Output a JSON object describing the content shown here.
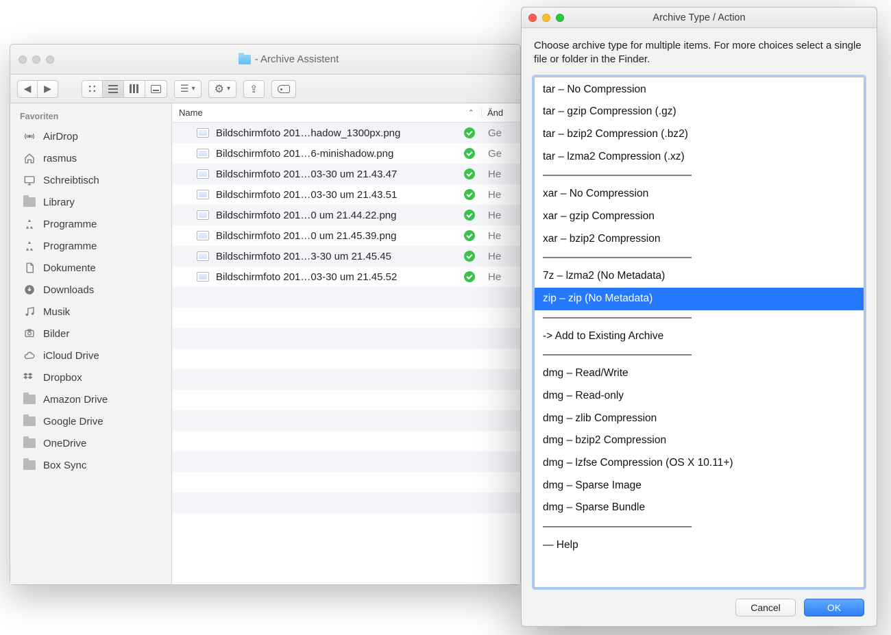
{
  "finder": {
    "title": " - Archive Assistent",
    "sidebar_header": "Favoriten",
    "sidebar": [
      {
        "icon": "airdrop",
        "label": "AirDrop"
      },
      {
        "icon": "home",
        "label": "rasmus"
      },
      {
        "icon": "desktop",
        "label": "Schreibtisch"
      },
      {
        "icon": "folder",
        "label": "Library"
      },
      {
        "icon": "apps",
        "label": "Programme"
      },
      {
        "icon": "apps",
        "label": "Programme"
      },
      {
        "icon": "documents",
        "label": "Dokumente"
      },
      {
        "icon": "downloads",
        "label": "Downloads"
      },
      {
        "icon": "music",
        "label": "Musik"
      },
      {
        "icon": "pictures",
        "label": "Bilder"
      },
      {
        "icon": "cloud",
        "label": "iCloud Drive"
      },
      {
        "icon": "dropbox",
        "label": "Dropbox"
      },
      {
        "icon": "folder",
        "label": "Amazon Drive"
      },
      {
        "icon": "folder",
        "label": "Google Drive"
      },
      {
        "icon": "folder",
        "label": "OneDrive"
      },
      {
        "icon": "folder",
        "label": "Box Sync"
      }
    ],
    "columns": {
      "name": "Name",
      "mod": "Änd"
    },
    "files": [
      {
        "name": "Bildschirmfoto 201…hadow_1300px.png",
        "mod": "Ge"
      },
      {
        "name": "Bildschirmfoto 201…6-minishadow.png",
        "mod": "Ge"
      },
      {
        "name": "Bildschirmfoto 201…03-30 um 21.43.47",
        "mod": "He"
      },
      {
        "name": "Bildschirmfoto 201…03-30 um 21.43.51",
        "mod": "He"
      },
      {
        "name": "Bildschirmfoto 201…0 um 21.44.22.png",
        "mod": "He"
      },
      {
        "name": "Bildschirmfoto 201…0 um 21.45.39.png",
        "mod": "He"
      },
      {
        "name": "Bildschirmfoto 201…3-30 um 21.45.45",
        "mod": "He"
      },
      {
        "name": "Bildschirmfoto 201…03-30 um 21.45.52",
        "mod": "He"
      }
    ],
    "empty_rows": 12
  },
  "dialog": {
    "title": "Archive Type / Action",
    "description": "Choose archive type for multiple items. For more choices select a single file or folder in the Finder.",
    "separator": "——————————————",
    "items": [
      {
        "t": "item",
        "label": "tar – No Compression"
      },
      {
        "t": "item",
        "label": "tar – gzip Compression (.gz)"
      },
      {
        "t": "item",
        "label": "tar – bzip2 Compression (.bz2)"
      },
      {
        "t": "item",
        "label": "tar – lzma2 Compression (.xz)"
      },
      {
        "t": "sep"
      },
      {
        "t": "item",
        "label": "xar – No Compression"
      },
      {
        "t": "item",
        "label": "xar – gzip Compression"
      },
      {
        "t": "item",
        "label": "xar – bzip2 Compression"
      },
      {
        "t": "sep"
      },
      {
        "t": "item",
        "label": "7z – lzma2 (No Metadata)"
      },
      {
        "t": "item",
        "label": "zip – zip (No Metadata)",
        "selected": true
      },
      {
        "t": "sep"
      },
      {
        "t": "item",
        "label": "-> Add to Existing Archive"
      },
      {
        "t": "sep"
      },
      {
        "t": "item",
        "label": "dmg – Read/Write"
      },
      {
        "t": "item",
        "label": "dmg – Read-only"
      },
      {
        "t": "item",
        "label": "dmg – zlib Compression"
      },
      {
        "t": "item",
        "label": "dmg – bzip2 Compression"
      },
      {
        "t": "item",
        "label": "dmg – lzfse Compression (OS X 10.11+)"
      },
      {
        "t": "item",
        "label": "dmg – Sparse Image"
      },
      {
        "t": "item",
        "label": "dmg – Sparse Bundle"
      },
      {
        "t": "sep"
      },
      {
        "t": "item",
        "label": "— Help"
      }
    ],
    "buttons": {
      "cancel": "Cancel",
      "ok": "OK"
    }
  }
}
